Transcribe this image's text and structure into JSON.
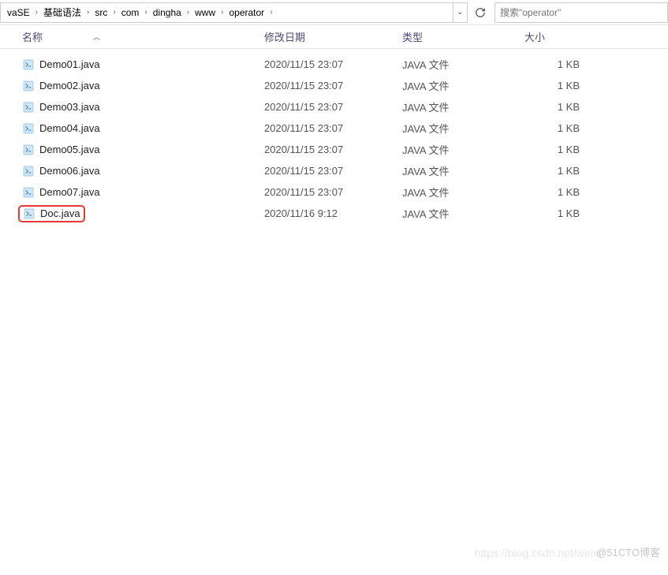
{
  "breadcrumb": {
    "items": [
      "vaSE",
      "基础语法",
      "src",
      "com",
      "dingha",
      "www",
      "operator"
    ]
  },
  "search": {
    "placeholder": "搜索\"operator\""
  },
  "columns": {
    "name": "名称",
    "date": "修改日期",
    "type": "类型",
    "size": "大小"
  },
  "files": [
    {
      "name": "Demo01.java",
      "date": "2020/11/15 23:07",
      "type": "JAVA 文件",
      "size": "1 KB",
      "highlighted": false
    },
    {
      "name": "Demo02.java",
      "date": "2020/11/15 23:07",
      "type": "JAVA 文件",
      "size": "1 KB",
      "highlighted": false
    },
    {
      "name": "Demo03.java",
      "date": "2020/11/15 23:07",
      "type": "JAVA 文件",
      "size": "1 KB",
      "highlighted": false
    },
    {
      "name": "Demo04.java",
      "date": "2020/11/15 23:07",
      "type": "JAVA 文件",
      "size": "1 KB",
      "highlighted": false
    },
    {
      "name": "Demo05.java",
      "date": "2020/11/15 23:07",
      "type": "JAVA 文件",
      "size": "1 KB",
      "highlighted": false
    },
    {
      "name": "Demo06.java",
      "date": "2020/11/15 23:07",
      "type": "JAVA 文件",
      "size": "1 KB",
      "highlighted": false
    },
    {
      "name": "Demo07.java",
      "date": "2020/11/15 23:07",
      "type": "JAVA 文件",
      "size": "1 KB",
      "highlighted": false
    },
    {
      "name": "Doc.java",
      "date": "2020/11/16 9:12",
      "type": "JAVA 文件",
      "size": "1 KB",
      "highlighted": true
    }
  ],
  "watermarks": {
    "w1": "https://blog.csdn.net/weixi",
    "w2": "@51CTO博客"
  }
}
